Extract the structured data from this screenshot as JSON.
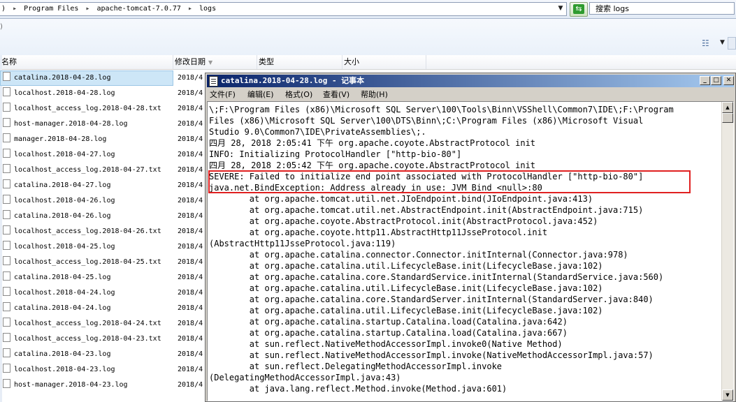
{
  "explorer": {
    "breadcrumb": [
      ")",
      "Program Files",
      "apache-tomcat-7.0.77",
      "logs"
    ],
    "breadcrumb_sep": "▸",
    "search_placeholder": "搜索 logs",
    "columns": {
      "name": "名称",
      "date": "修改日期",
      "type": "类型",
      "size": "大小"
    },
    "files": [
      {
        "name": "catalina.2018-04-28.log",
        "date": "2018/4"
      },
      {
        "name": "localhost.2018-04-28.log",
        "date": "2018/4"
      },
      {
        "name": "localhost_access_log.2018-04-28.txt",
        "date": "2018/4"
      },
      {
        "name": "host-manager.2018-04-28.log",
        "date": "2018/4"
      },
      {
        "name": "manager.2018-04-28.log",
        "date": "2018/4"
      },
      {
        "name": "localhost.2018-04-27.log",
        "date": "2018/4"
      },
      {
        "name": "localhost_access_log.2018-04-27.txt",
        "date": "2018/4"
      },
      {
        "name": "catalina.2018-04-27.log",
        "date": "2018/4"
      },
      {
        "name": "localhost.2018-04-26.log",
        "date": "2018/4"
      },
      {
        "name": "catalina.2018-04-26.log",
        "date": "2018/4"
      },
      {
        "name": "localhost_access_log.2018-04-26.txt",
        "date": "2018/4"
      },
      {
        "name": "localhost.2018-04-25.log",
        "date": "2018/4"
      },
      {
        "name": "localhost_access_log.2018-04-25.txt",
        "date": "2018/4"
      },
      {
        "name": "catalina.2018-04-25.log",
        "date": "2018/4"
      },
      {
        "name": "localhost.2018-04-24.log",
        "date": "2018/4"
      },
      {
        "name": "catalina.2018-04-24.log",
        "date": "2018/4"
      },
      {
        "name": "localhost_access_log.2018-04-24.txt",
        "date": "2018/4"
      },
      {
        "name": "localhost_access_log.2018-04-23.txt",
        "date": "2018/4"
      },
      {
        "name": "catalina.2018-04-23.log",
        "date": "2018/4"
      },
      {
        "name": "localhost.2018-04-23.log",
        "date": "2018/4"
      },
      {
        "name": "host-manager.2018-04-23.log",
        "date": "2018/4"
      }
    ],
    "selected_index": 0
  },
  "notepad": {
    "title": "catalina.2018-04-28.log - 记事本",
    "menu": [
      "文件(F)",
      "编辑(E)",
      "格式(O)",
      "查看(V)",
      "帮助(H)"
    ],
    "lines": [
      "\\;F:\\Program Files (x86)\\Microsoft SQL Server\\100\\Tools\\Binn\\VSShell\\Common7\\IDE\\;F:\\Program",
      "Files (x86)\\Microsoft SQL Server\\100\\DTS\\Binn\\;C:\\Program Files (x86)\\Microsoft Visual",
      "Studio 9.0\\Common7\\IDE\\PrivateAssemblies\\;.",
      "四月 28, 2018 2:05:41 下午 org.apache.coyote.AbstractProtocol init",
      "INFO: Initializing ProtocolHandler [\"http-bio-80\"]",
      "四月 28, 2018 2:05:42 下午 org.apache.coyote.AbstractProtocol init",
      "SEVERE: Failed to initialize end point associated with ProtocolHandler [\"http-bio-80\"]",
      "java.net.BindException: Address already in use: JVM_Bind <null>:80",
      "        at org.apache.tomcat.util.net.JIoEndpoint.bind(JIoEndpoint.java:413)",
      "        at org.apache.tomcat.util.net.AbstractEndpoint.init(AbstractEndpoint.java:715)",
      "        at org.apache.coyote.AbstractProtocol.init(AbstractProtocol.java:452)",
      "        at org.apache.coyote.http11.AbstractHttp11JsseProtocol.init",
      "(AbstractHttp11JsseProtocol.java:119)",
      "        at org.apache.catalina.connector.Connector.initInternal(Connector.java:978)",
      "        at org.apache.catalina.util.LifecycleBase.init(LifecycleBase.java:102)",
      "        at org.apache.catalina.core.StandardService.initInternal(StandardService.java:560)",
      "        at org.apache.catalina.util.LifecycleBase.init(LifecycleBase.java:102)",
      "        at org.apache.catalina.core.StandardServer.initInternal(StandardServer.java:840)",
      "        at org.apache.catalina.util.LifecycleBase.init(LifecycleBase.java:102)",
      "        at org.apache.catalina.startup.Catalina.load(Catalina.java:642)",
      "        at org.apache.catalina.startup.Catalina.load(Catalina.java:667)",
      "        at sun.reflect.NativeMethodAccessorImpl.invoke0(Native Method)",
      "        at sun.reflect.NativeMethodAccessorImpl.invoke(NativeMethodAccessorImpl.java:57)",
      "        at sun.reflect.DelegatingMethodAccessorImpl.invoke",
      "(DelegatingMethodAccessorImpl.java:43)",
      "        at java.lang.reflect.Method.invoke(Method.java:601)"
    ],
    "highlight_color": "#e02020"
  },
  "icons": [
    "file-icon",
    "refresh-icon",
    "view-icon",
    "minimize-icon",
    "maximize-icon",
    "close-icon",
    "notepad-icon"
  ]
}
